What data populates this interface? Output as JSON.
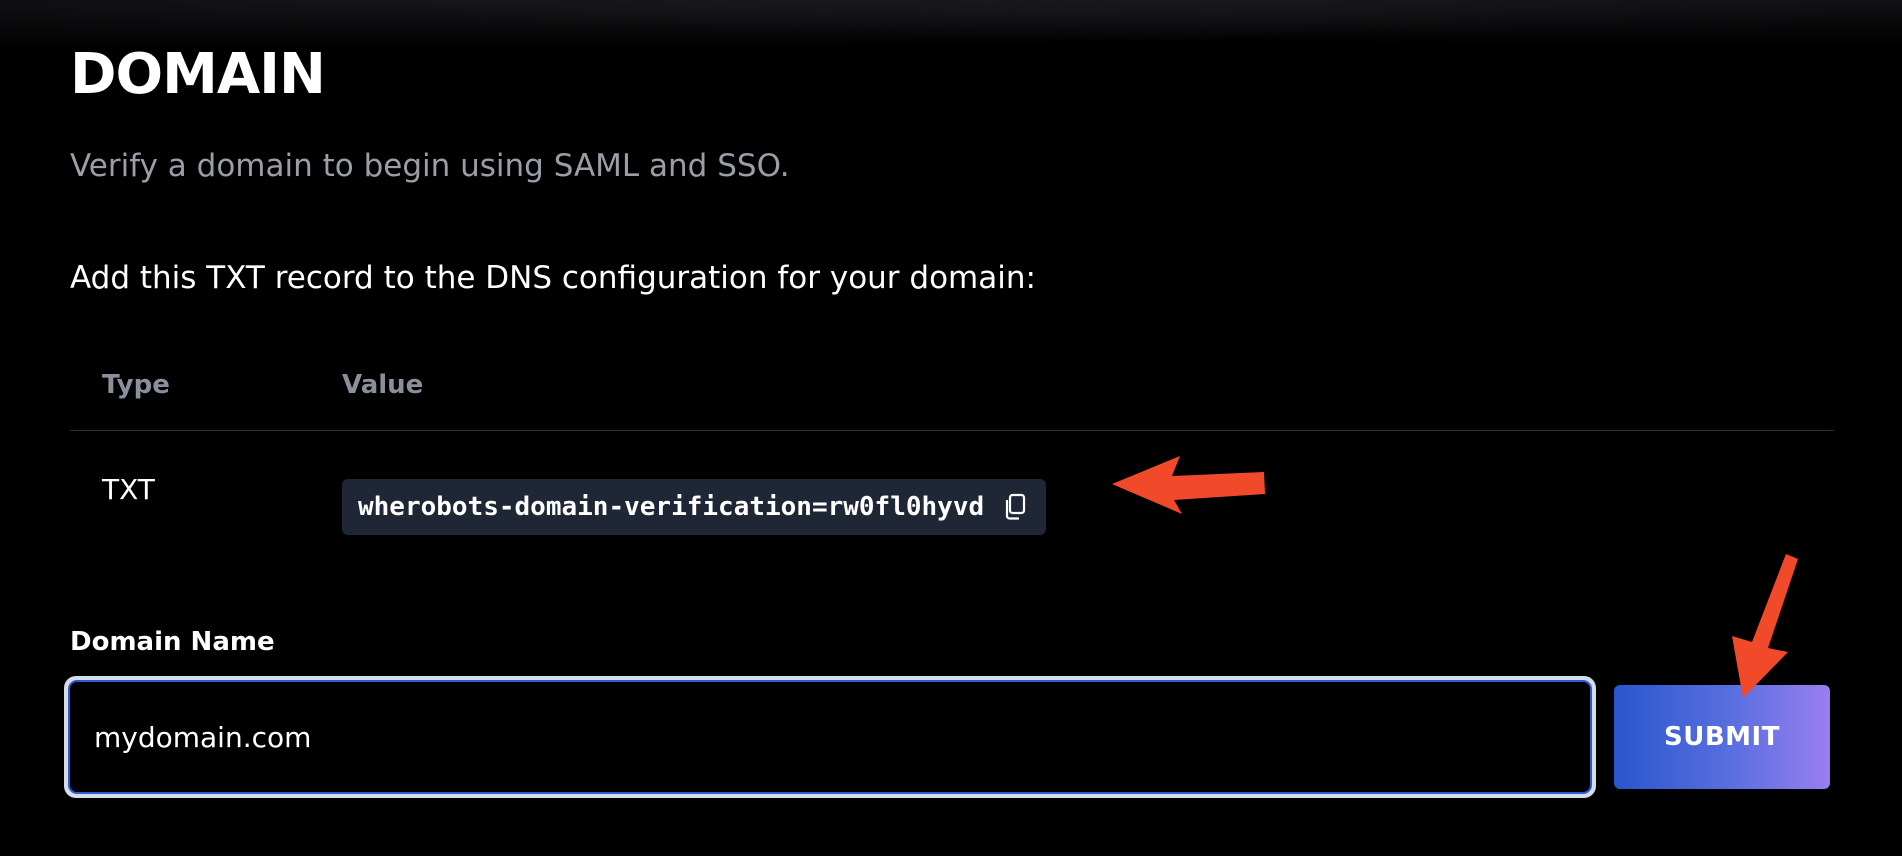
{
  "header": {
    "title": "DOMAIN",
    "subtitle": "Verify a domain to begin using SAML and SSO."
  },
  "instructions": "Add this TXT record to the DNS configuration for your domain:",
  "record_table": {
    "columns": [
      "Type",
      "Value"
    ],
    "rows": [
      {
        "type": "TXT",
        "value": "wherobots-domain-verification=rw0fl0hyvd"
      }
    ]
  },
  "form": {
    "label": "Domain Name",
    "value": "mydomain.com",
    "submit_label": "SUBMIT"
  },
  "icons": {
    "copy": "copy-icon",
    "annotation": "arrow-icon"
  },
  "colors": {
    "background": "#000000",
    "chip": "#1f2635",
    "annotation_arrow": "#f04a2a",
    "button_gradient_start": "#2a56cc",
    "button_gradient_end": "#9a7ef0"
  }
}
